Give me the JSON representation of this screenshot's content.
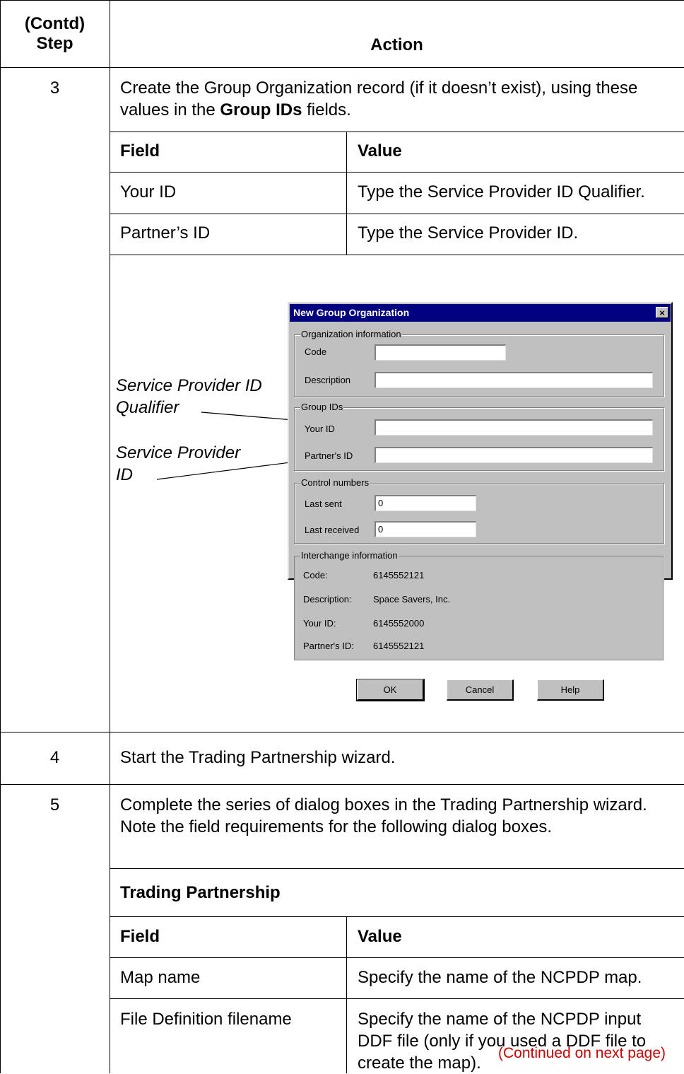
{
  "header": {
    "step": "(Contd)\nStep",
    "action": "Action"
  },
  "step3": {
    "number": "3",
    "text_before": "Create the Group Organization record (if it doesn’t exist), using these values in the ",
    "text_bold": "Group IDs",
    "text_after": " fields.",
    "table": {
      "headers": [
        "Field",
        "Value"
      ],
      "rows": [
        [
          "Your ID",
          "Type the Service Provider ID Qualifier."
        ],
        [
          "Partner’s ID",
          "Type the Service Provider ID."
        ]
      ]
    },
    "callouts": {
      "qualifier": "Service Provider ID Qualifier",
      "id": "Service Provider ID"
    },
    "dialog": {
      "title": "New Group Organization",
      "close": "×",
      "org_group": "Organization information",
      "code_label": "Code",
      "code_value": "",
      "description_label": "Description",
      "description_value": "",
      "group_ids": "Group IDs",
      "your_id_label": "Your ID",
      "your_id_value": "",
      "partners_id_label": "Partner's ID",
      "partners_id_value": "",
      "control_group": "Control numbers",
      "last_sent_label": "Last sent",
      "last_sent_value": "0",
      "last_received_label": "Last received",
      "last_received_value": "0",
      "interchange_group": "Interchange information",
      "ic_code_label": "Code:",
      "ic_code_value": "6145552121",
      "ic_description_label": "Description:",
      "ic_description_value": "Space Savers, Inc.",
      "ic_your_id_label": "Your ID:",
      "ic_your_id_value": "6145552000",
      "ic_partners_id_label": "Partner's ID:",
      "ic_partners_id_value": "6145552121",
      "ok": "OK",
      "cancel": "Cancel",
      "help": "Help"
    }
  },
  "step4": {
    "number": "4",
    "text": "Start the Trading Partnership wizard."
  },
  "step5": {
    "number": "5",
    "text": "Complete the series of dialog boxes in the Trading Partnership wizard. Note the field requirements for the following dialog boxes.",
    "section_title": "Trading Partnership",
    "table": {
      "headers": [
        "Field",
        "Value"
      ],
      "rows": [
        [
          "Map name",
          "Specify the name of the NCPDP map."
        ],
        [
          "File Definition filename",
          "Specify the name of the NCPDP input DDF file (only if you used a DDF file to create the map)."
        ]
      ]
    },
    "continued": "(Continued on next page)"
  },
  "colors": {
    "continued": "#cc0000",
    "titlebar": "#000080",
    "dialog_bg": "#c0c0c0"
  }
}
